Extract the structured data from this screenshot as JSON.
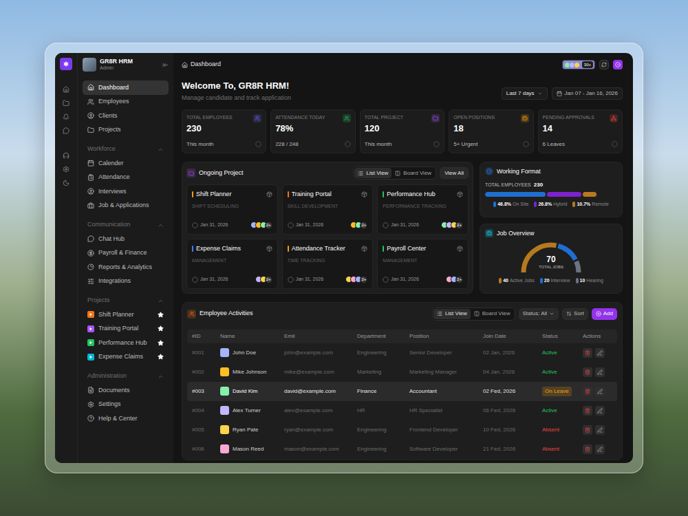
{
  "app": {
    "name": "GR8R HRM",
    "role": "Admin"
  },
  "sidebar": {
    "nav": [
      {
        "label": "Dashboard",
        "selected": true
      },
      {
        "label": "Employees",
        "selected": false
      },
      {
        "label": "Clients",
        "selected": false
      },
      {
        "label": "Projects",
        "selected": false
      }
    ],
    "sections": [
      {
        "title": "Workforce",
        "expanded": true,
        "kind": "links",
        "items": [
          {
            "label": "Calender",
            "selected": false
          },
          {
            "label": "Attendance",
            "selected": false
          },
          {
            "label": "Interviews",
            "selected": false
          },
          {
            "label": "Job & Applications",
            "selected": false
          }
        ]
      },
      {
        "title": "Communication",
        "expanded": true,
        "kind": "links",
        "items": [
          {
            "label": "Chat Hub",
            "selected": false
          },
          {
            "label": "Payroll & Finance",
            "selected": false
          },
          {
            "label": "Reports & Analytics",
            "selected": false
          },
          {
            "label": "Integrations",
            "selected": false
          }
        ]
      },
      {
        "title": "Projects",
        "expanded": true,
        "kind": "projects",
        "items": [
          {
            "label": "Shift Planner",
            "selected": false,
            "starred": true,
            "color": "#f97316"
          },
          {
            "label": "Training Portal",
            "selected": false,
            "starred": true,
            "color": "#a855f7"
          },
          {
            "label": "Performance Hub",
            "selected": false,
            "starred": true,
            "color": "#22c55e"
          },
          {
            "label": "Expense Claims",
            "selected": false,
            "starred": true,
            "color": "#06b6d4"
          }
        ]
      },
      {
        "title": "Administration",
        "expanded": true,
        "kind": "links",
        "items": [
          {
            "label": "Documents",
            "selected": false
          },
          {
            "label": "Settings",
            "selected": false
          },
          {
            "label": "Help & Center",
            "selected": false
          }
        ]
      }
    ]
  },
  "header": {
    "breadcrumb": "Dashboard",
    "avatar_count": "30+"
  },
  "welcome": {
    "title": "Welcome To, GR8R HRM!",
    "subtitle": "Manage candidate and track application"
  },
  "date_filter": {
    "range": "Last 7 days",
    "dates": "Jan 07 - Jan 16, 2026"
  },
  "stats": [
    {
      "label": "TOTAL EMPLOYEES",
      "value": "230",
      "note": "This month",
      "color": "#6366f1"
    },
    {
      "label": "ATTENDANCE TODAY",
      "value": "78%",
      "note": "228 / 248",
      "color": "#22c55e"
    },
    {
      "label": "TOTAL PROJECT",
      "value": "120",
      "note": "This month",
      "color": "#a855f7"
    },
    {
      "label": "OPEN POSITIONS",
      "value": "18",
      "note": "5+ Urgent",
      "color": "#f59e0b"
    },
    {
      "label": "PENDING APPROVALS",
      "value": "14",
      "note": "6 Leaves",
      "color": "#ef4444"
    }
  ],
  "ongoing_project": {
    "title": "Ongoing Project",
    "views": [
      {
        "label": "List View",
        "selected": true
      },
      {
        "label": "Board View",
        "selected": false
      }
    ],
    "view_all": "View All",
    "projects": [
      {
        "name": "Shift Planner",
        "category": "SHIFT SCHEDULING",
        "date": "Jan 31, 2026",
        "avatars": 3,
        "more": "2+",
        "color": "#f59e0b"
      },
      {
        "name": "Training Portal",
        "category": "SKILL DEVELOPMENT",
        "date": "Jan 31, 2026",
        "avatars": 2,
        "more": "2+",
        "color": "#f97316"
      },
      {
        "name": "Performance Hub",
        "category": "PERFORMANCE TRACKING",
        "date": "Jan 31, 2026",
        "avatars": 3,
        "more": "2+",
        "color": "#22c55e"
      },
      {
        "name": "Expense Claims",
        "category": "MANAGEMENT",
        "date": "Jan 31, 2026",
        "avatars": 2,
        "more": "2+",
        "color": "#3b82f6"
      },
      {
        "name": "Attendance Tracker",
        "category": "TIME TRACKING",
        "date": "Jan 31, 2026",
        "avatars": 3,
        "more": "2+",
        "color": "#f59e0b"
      },
      {
        "name": "Payroll Center",
        "category": "MANAGEMENT",
        "date": "Jan 31, 2026",
        "avatars": 2,
        "more": "2+",
        "color": "#22c55e"
      }
    ]
  },
  "working_format": {
    "title": "Working Format",
    "total_label": "TOTAL EMPLOYEES",
    "total": "230",
    "segments": [
      {
        "percent": "46.8%",
        "label": "On Site",
        "level": 0.468,
        "color": "#1f6fd1"
      },
      {
        "percent": "26.8%",
        "label": "Hybrid",
        "level": 0.268,
        "color": "#7e22ce"
      },
      {
        "percent": "10.7%",
        "label": "Remote",
        "level": 0.107,
        "color": "#b7791f"
      }
    ]
  },
  "job_overview": {
    "title": "Job Overview",
    "total": "70",
    "total_label": "TOTAL JOBS",
    "segments": [
      {
        "count": "40",
        "label": "Active Jobs",
        "value": 40,
        "color": "#b7791f"
      },
      {
        "count": "20",
        "label": "Interview",
        "value": 20,
        "color": "#1f6fd1"
      },
      {
        "count": "10",
        "label": "Hearing",
        "value": 10,
        "color": "#6b7280"
      }
    ]
  },
  "employee_activities": {
    "title": "Employee Activities",
    "views": [
      {
        "label": "List View",
        "selected": true
      },
      {
        "label": "Board View",
        "selected": false
      }
    ],
    "status_filter": "Status: All",
    "sort": "Sort",
    "add": "Add",
    "columns": [
      "#ID",
      "Name",
      "Emil",
      "Department",
      "Position",
      "Join Date",
      "Status",
      "Actions"
    ],
    "rows": [
      {
        "id": "#001",
        "name": "John Doe",
        "email": "john@example.com",
        "department": "Engineering",
        "position": "Senior Developer",
        "join_date": "02 Jan, 2026",
        "status": "Active",
        "status_kind": "text",
        "status_color": "#22c55e",
        "selected": false
      },
      {
        "id": "#002",
        "name": "Mike Johnson",
        "email": "mike@example.com",
        "department": "Marketing",
        "position": "Marketing Manager",
        "join_date": "04 Jan, 2026",
        "status": "Active",
        "status_kind": "text",
        "status_color": "#22c55e",
        "selected": false
      },
      {
        "id": "#003",
        "name": "David Kim",
        "email": "david@example.com",
        "department": "Finance",
        "position": "Accountant",
        "join_date": "02 Fed, 2026",
        "status": "On Leave",
        "status_kind": "badge",
        "status_color": "#f59e0b",
        "selected": true
      },
      {
        "id": "#004",
        "name": "Alex Turner",
        "email": "alex@example.com",
        "department": "HR",
        "position": "HR Specialist",
        "join_date": "06 Fed, 2026",
        "status": "Active",
        "status_kind": "text",
        "status_color": "#22c55e",
        "selected": false
      },
      {
        "id": "#005",
        "name": "Ryan Pate",
        "email": "ryan@example.com",
        "department": "Engineering",
        "position": "Frontend Developer",
        "join_date": "10 Fed, 2026",
        "status": "Absent",
        "status_kind": "text",
        "status_color": "#ef4444",
        "selected": false
      },
      {
        "id": "#006",
        "name": "Mason Reed",
        "email": "mason@example.com",
        "department": "Engineering",
        "position": "Software Developer",
        "join_date": "21 Fed, 2026",
        "status": "Absent",
        "status_kind": "text",
        "status_color": "#ef4444",
        "selected": false
      }
    ]
  }
}
